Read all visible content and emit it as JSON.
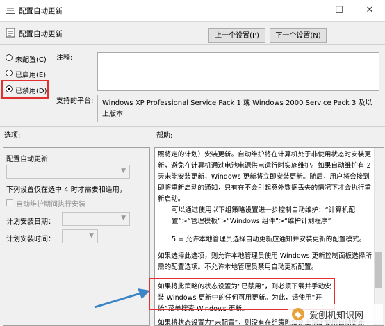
{
  "window": {
    "title": "配置自动更新",
    "controls": [
      "—",
      "☐",
      "✕"
    ]
  },
  "header": {
    "policy_title": "配置自动更新",
    "prev_button": "上一个设置(P)",
    "next_button": "下一个设置(N)"
  },
  "state": {
    "options": [
      {
        "label": "未配置(C)",
        "checked": false
      },
      {
        "label": "已启用(E)",
        "checked": false
      },
      {
        "label": "已禁用(D)",
        "checked": true
      }
    ]
  },
  "comment": {
    "label": "注释:",
    "value": ""
  },
  "platform": {
    "label": "支持的平台:",
    "value": "Windows XP Professional Service Pack 1 或 Windows 2000 Service Pack 3 及以上版本"
  },
  "sections": {
    "options_label": "选项:",
    "help_label": "帮助:"
  },
  "options_panel": {
    "configure_label": "配置自动更新:",
    "note": "下列设置仅在选中 4 时才需要和适用。",
    "maintenance_checkbox": "自动维护期间执行安装",
    "schedule_day_label": "计划安装日期：",
    "schedule_time_label": "计划安装时间："
  },
  "help": {
    "p1": "照将定的计划）安装更新。自动维护将在计算机处于非使用状态时安装更新，避免在计算机通过电池电源供电运行时实施维护。如果自动维护有 2 天未能安装更新，Windows 更新将立即安装更新。随后，用户将会接到即将重新启动的通知，只有在不会引起意外数据丢失的情况下才会执行重新启动。",
    "p2": "可以通过使用以下组策略设置进一步控制自动维护：“计算机配置”>“管理模板”>“Windows 组件”>“维护计划程序”",
    "p3": "5 = 允许本地管理员选择自动更新应通知并安装更新的配置模式。",
    "p4": "如果选择此选项，则允许本地管理员使用 Windows 更新控制面板选择所需的配置选项。不允许本地管理员禁用自动更新配置。",
    "p5": "如果将此策略的状态设置为“已禁用”，则必须下载并手动安装 Windows 更新中的任何可用更新。为此，请使用“开始”菜单搜索 Windows 更新。",
    "p6": "如果将状态设置为“未配置”，则没有在组策略级别上指定使用自动更新"
  },
  "watermark": {
    "text": "爱刨机知识网"
  },
  "colors": {
    "annotation_red": "#e03030",
    "arrow_blue": "#3d86c6"
  }
}
